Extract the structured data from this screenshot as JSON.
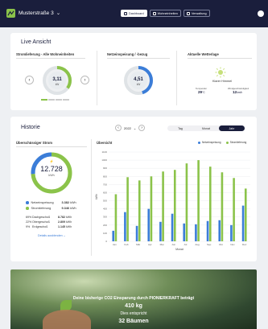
{
  "header": {
    "project": "Musterstraße 3",
    "tabs": [
      {
        "label": "Dashboard",
        "active": true
      },
      {
        "label": "Wohneinheiten",
        "active": false
      },
      {
        "label": "Verwaltung",
        "active": false
      }
    ]
  },
  "live": {
    "title": "Live Ansicht",
    "stromlieferung": {
      "label": "Stromlieferung - Alle Wohneinheiten",
      "value": "3,11",
      "unit": "kW",
      "fill": 0.35
    },
    "netz": {
      "label": "Netzeinspeisung / -bezug",
      "value": "4,51",
      "unit": "kW",
      "fill": 0.45
    },
    "wetter": {
      "label": "Aktuelle Wetterlage",
      "condition": "Klarer Himmel",
      "temp_label": "Temperatur",
      "temp": "29",
      "temp_unit": "°C",
      "wind_label": "Windgeschwindigkeit",
      "wind": "12",
      "wind_unit": "km/h"
    }
  },
  "history": {
    "title": "Historie",
    "year": "2022",
    "periods": [
      {
        "label": "Tag",
        "active": false
      },
      {
        "label": "Monat",
        "active": false
      },
      {
        "label": "Jahr",
        "active": true
      }
    ],
    "summary": {
      "title": "Überschüssiger Strom",
      "total": "12.728",
      "unit": "kWh",
      "fill_green": 0.74,
      "legend": [
        {
          "label": "Netzeinspeisung",
          "value": "3.382",
          "unit": "kWh",
          "color": "#3b7dd8"
        },
        {
          "label": "Stromlieferung",
          "value": "9.346",
          "unit": "kWh",
          "color": "#8bc34a"
        }
      ],
      "rows": [
        {
          "pct": "69%",
          "label": "Dachgeschoß",
          "value": "8.782",
          "unit": "kWh"
        },
        {
          "pct": "22%",
          "label": "Obergeschoß",
          "value": "2.809",
          "unit": "kWh"
        },
        {
          "pct": "9%",
          "label": "Erdgeschoß",
          "value": "1.145",
          "unit": "kWh"
        }
      ],
      "details_link": "Details ausblenden"
    }
  },
  "chart_data": {
    "type": "bar",
    "title": "Übersicht",
    "ylabel": "kWh",
    "xlabel": "Monat",
    "categories": [
      "Jan",
      "Feb",
      "Mär",
      "Apr",
      "Mai",
      "Jun",
      "Jul",
      "Aug",
      "Sep",
      "Okt",
      "Nov",
      "Dez"
    ],
    "ylim": [
      0,
      1100
    ],
    "yticks": [
      0,
      100,
      200,
      300,
      400,
      500,
      600,
      700,
      800,
      900,
      1000,
      1100
    ],
    "series": [
      {
        "name": "Netzeinspeisung",
        "color": "#3b7dd8",
        "values": [
          130,
          360,
          190,
          400,
          240,
          340,
          220,
          210,
          250,
          260,
          200,
          440
        ]
      },
      {
        "name": "Stromlieferung",
        "color": "#8bc34a",
        "values": [
          580,
          790,
          750,
          800,
          860,
          880,
          960,
          1000,
          920,
          850,
          780,
          650
        ]
      }
    ],
    "legend_position": "top-right"
  },
  "banner": {
    "line1": "Deine bisherige CO2 Einsparung durch PIONIERKRAFT beträgt",
    "amount": "410 kg",
    "line3": "Dies entspricht",
    "trees": "32 Bäumen"
  }
}
